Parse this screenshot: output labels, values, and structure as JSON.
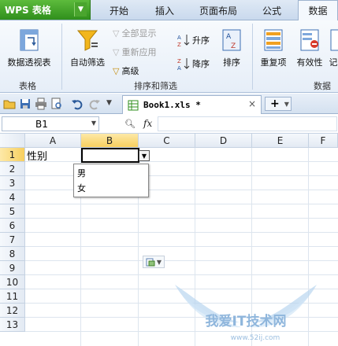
{
  "app": {
    "logo_text": "WPS 表格"
  },
  "menu": {
    "tabs": [
      "开始",
      "插入",
      "页面布局",
      "公式",
      "数据"
    ],
    "active_tab": "数据"
  },
  "ribbon": {
    "table_group": {
      "pivot_label": "数据透视表",
      "group_label": "表格"
    },
    "sort_filter_group": {
      "autofilter_label": "自动筛选",
      "show_all_label": "全部显示",
      "reapply_label": "重新应用",
      "advanced_label": "高级",
      "sort_asc_label": "升序",
      "sort_desc_label": "降序",
      "sort_label": "排序",
      "group_label": "排序和筛选"
    },
    "data_tools_group": {
      "duplicates_label": "重复项",
      "validity_label": "有效性",
      "partial_next_label": "记",
      "partial_group_label": "数据"
    }
  },
  "document": {
    "tab_name": "Book1.xls *",
    "close": "×",
    "new_tab": "+"
  },
  "formula_bar": {
    "name_box": "B1",
    "fx": "fx"
  },
  "sheet": {
    "columns": [
      "A",
      "B",
      "C",
      "D",
      "E",
      "F"
    ],
    "rows": [
      "1",
      "2",
      "3",
      "4",
      "5",
      "6",
      "7",
      "8",
      "9",
      "10",
      "11",
      "12",
      "13"
    ],
    "selected_column": "B",
    "selected_row": "1",
    "cell_a1": "性别"
  },
  "validation_list": {
    "options": [
      "男",
      "女"
    ]
  },
  "watermark": {
    "text": "我爱IT技术网",
    "url": "www.52ij.com"
  }
}
